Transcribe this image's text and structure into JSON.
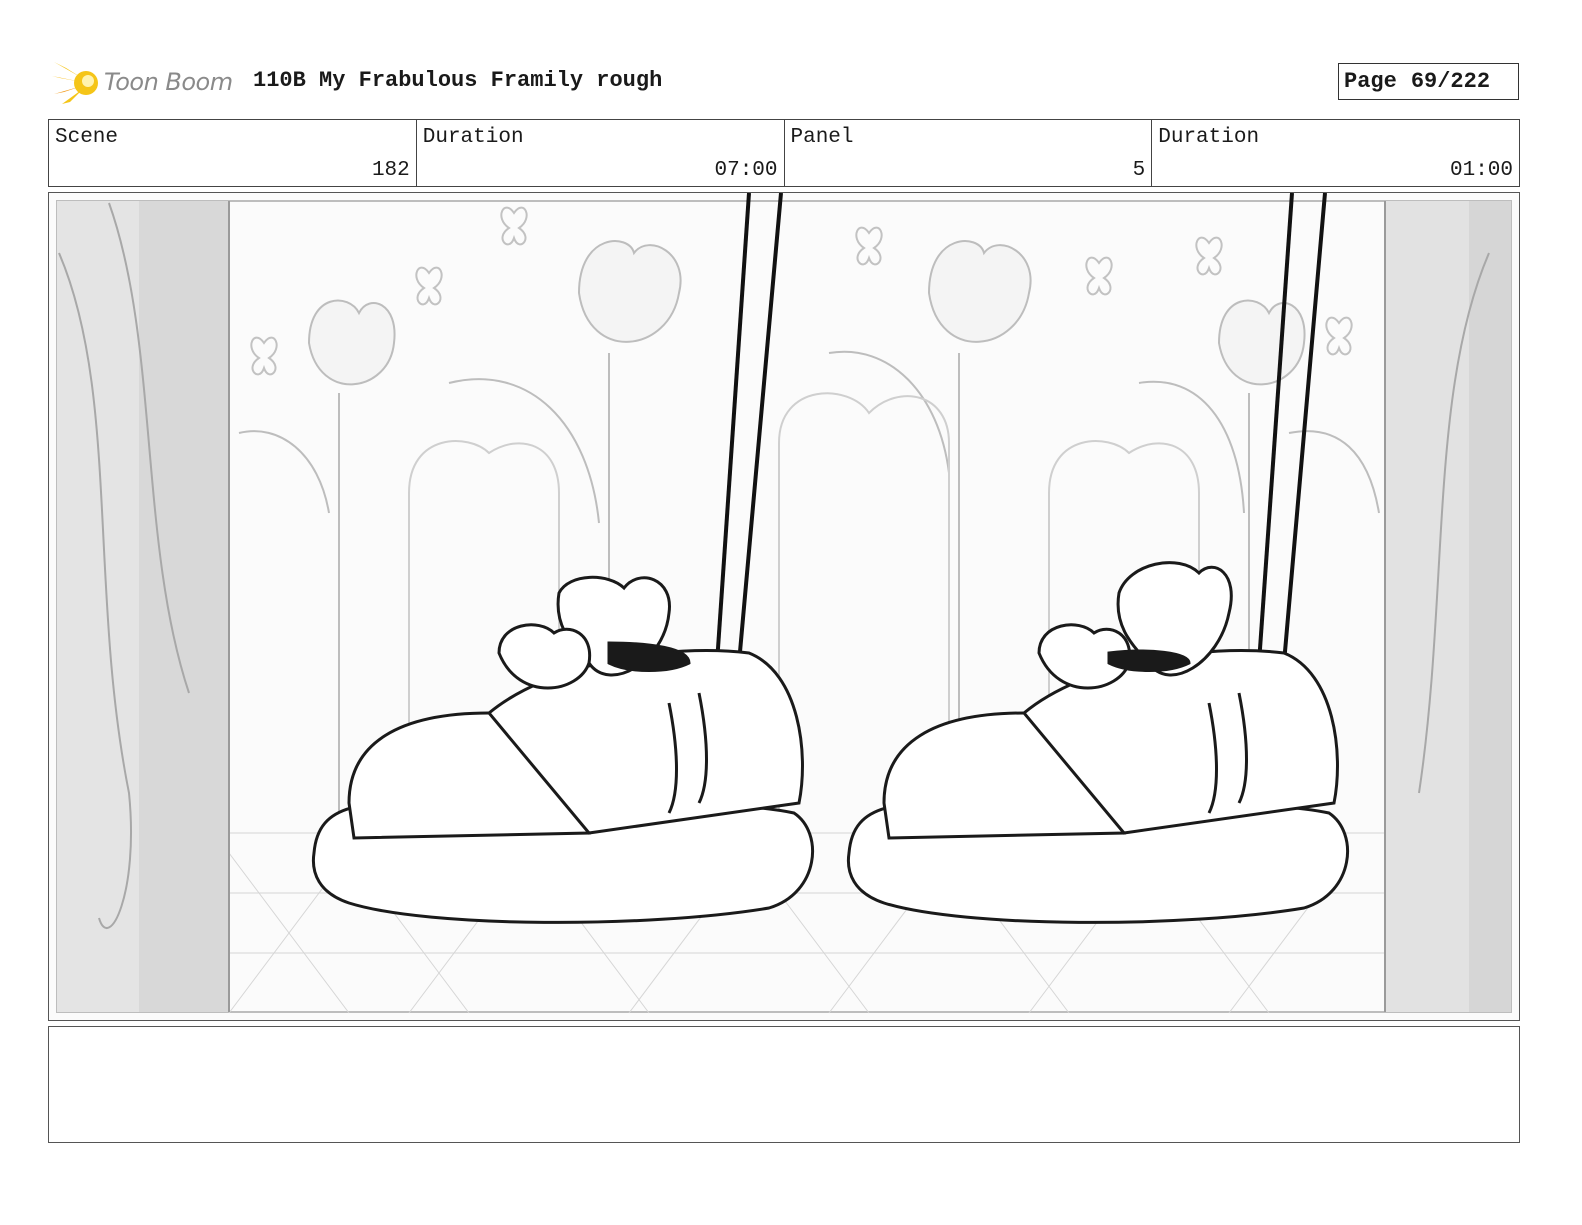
{
  "header": {
    "logo_text": "Toon Boom",
    "logo_icon": "starburst-icon",
    "title": "110B My Frabulous Framily rough",
    "page_label": "Page",
    "page_value": "69/222"
  },
  "info": {
    "scene_label": "Scene",
    "scene_value": "182",
    "scene_duration_label": "Duration",
    "scene_duration_value": "07:00",
    "panel_label": "Panel",
    "panel_value": "5",
    "panel_duration_label": "Duration",
    "panel_duration_value": "01:00"
  },
  "notes": {
    "text": ""
  },
  "colors": {
    "logo_yellow": "#f5c518",
    "logo_orange": "#f29b1d",
    "sketch_line": "#1a1a1a",
    "background_line": "#b8b8b8"
  }
}
